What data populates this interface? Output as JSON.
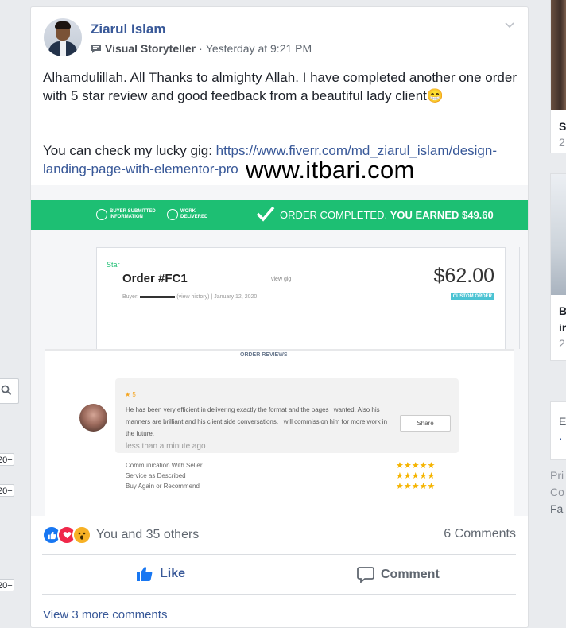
{
  "post": {
    "author": "Ziarul Islam",
    "badge": "Visual Storyteller",
    "separator": "·",
    "timestamp": "Yesterday at 9:21 PM",
    "text_line1": "Alhamdulillah. All Thanks to almighty Allah. I have completed another one order with 5 star review and good feedback from a beautiful lady client😁",
    "text_line2_prefix": "You can check my lucky gig: ",
    "gig_link": "https://www.fiverr.com/md_ziarul_islam/design-landing-page-with-elementor-pro",
    "watermark": "www.itbari.com"
  },
  "screenshot": {
    "step1": "BUYER SUBMITTED INFORMATION",
    "step2": "WORK DELIVERED",
    "completed": "ORDER COMPLETED.",
    "earned": "YOU EARNED $49.60",
    "star_label": "Star",
    "order_title": "Order #FC1",
    "view_gig": "view gig",
    "buyer_prefix": "Buyer:",
    "view_history": "(view history)",
    "order_date": "January 12, 2020",
    "price": "$62.00",
    "order_tag": "CUSTOM ORDER",
    "reviews_title": "ORDER REVIEWS",
    "reviewer_rating": "★ 5",
    "review_text": "He has been very efficient in delivering exactly the format and the pages i wanted. Also his manners are brilliant and his client side conversations. I will commission him for more work in the future.",
    "share": "Share",
    "review_time": "less than a minute ago",
    "ratings": [
      {
        "label": "Communication With Seller",
        "stars": 5
      },
      {
        "label": "Service as Described",
        "stars": 5
      },
      {
        "label": "Buy Again or Recommend",
        "stars": 5
      }
    ]
  },
  "footer": {
    "reactions_text": "You and 35 others",
    "comments_count": "6 Comments",
    "like": "Like",
    "comment": "Comment",
    "more_comments": "View 3 more comments"
  },
  "left_rail": {
    "counts": [
      "20+",
      "20+",
      "20+"
    ]
  },
  "right_rail": {
    "card1_letter": "S",
    "card1_num": "2",
    "card2_line1": "B",
    "card2_line2": "in",
    "card2_num": "2",
    "lang1": "En",
    "lang2": "· P",
    "footer1": "Pri",
    "footer2": "Co",
    "footer3": "Fa"
  },
  "colors": {
    "fiverr_green": "#1dbf73",
    "fb_blue": "#385898",
    "like_blue": "#1877f2",
    "love_red": "#f0284a",
    "wow_yellow": "#f7b125"
  }
}
